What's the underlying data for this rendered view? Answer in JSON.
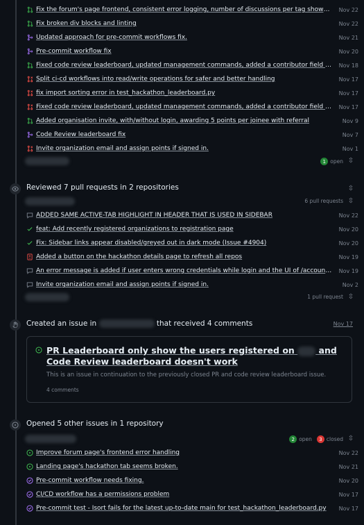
{
  "colors": {
    "open": "#3fb950",
    "closed": "#f85149",
    "merged": "#a371f7",
    "muted": "#7d8590"
  },
  "pr_list": {
    "items": [
      {
        "icon": "pr-open-icon",
        "title": "Fix the forum's page frontend, consistent error logging, number of discussions per tag shown, s...",
        "date": "Nov 22"
      },
      {
        "icon": "pr-open-icon",
        "title": "Fix broken div blocks and linting",
        "date": "Nov 22"
      },
      {
        "icon": "pr-merged-icon",
        "title": "Updated approach for pre-commit workflows fix.",
        "date": "Nov 21"
      },
      {
        "icon": "pr-merged-icon",
        "title": "Pre-commit workflow fix",
        "date": "Nov 20"
      },
      {
        "icon": "pr-open-icon",
        "title": "Fixed code review leaderboard, updated management commands, added a contributor field in t...",
        "date": "Nov 18"
      },
      {
        "icon": "pr-closed-icon",
        "title": "Split ci-cd workflows into read/write operations for safer and better handling",
        "date": "Nov 17"
      },
      {
        "icon": "pr-closed-icon",
        "title": "fix import sorting error in test_hackathon_leaderboard.py",
        "date": "Nov 17"
      },
      {
        "icon": "pr-closed-icon",
        "title": "Fixed code review leaderboard, updated management commands, added a contributor field in t...",
        "date": "Nov 17"
      },
      {
        "icon": "pr-open-icon",
        "title": "Added organisation invite, with/without login, awarding 5 points per joinee with referral",
        "date": "Nov 9"
      },
      {
        "icon": "pr-merged-icon",
        "title": "Code Review leaderboard fix",
        "date": "Nov 7"
      },
      {
        "icon": "pr-closed-icon",
        "title": "Invite organization email and assign points if signed in.",
        "date": "Nov 1"
      }
    ],
    "open_count": "1",
    "open_label": "open"
  },
  "reviews": {
    "title": "Reviewed 7 pull requests in 2 repositories",
    "count_label": "6 pull requests",
    "items": [
      {
        "icon": "comment-icon",
        "title": "ADDED SAME ACTIVE-TAB HIGHLIGHT IN HEADER THAT IS USED IN SIDEBAR",
        "date": "Nov 22"
      },
      {
        "icon": "check-icon",
        "title": "feat: Add recently registered organizations to registration page",
        "date": "Nov 20"
      },
      {
        "icon": "check-icon",
        "title": "Fix: Sidebar links appear disabled/greyed out in dark mode (Issue #4904)",
        "date": "Nov 20"
      },
      {
        "icon": "file-diff-icon",
        "title": "Added a button on the hackathon details page to refresh all repos",
        "date": "Nov 19"
      },
      {
        "icon": "comment-icon",
        "title": "An error message is added if user enters wrong credentials while login and the UI of /accounts/c...",
        "date": "Nov 19"
      },
      {
        "icon": "comment-icon",
        "title": "Invite organization email and assign points if signed in.",
        "date": "Nov 2"
      }
    ],
    "second_count_label": "1 pull request"
  },
  "created_issue": {
    "prefix": "Created an issue in",
    "suffix": "that received 4 comments",
    "date": "Nov 17",
    "card_title_a": "PR Leaderboard only show the users registered on",
    "card_title_b": "and Code Review leaderboard doesn't work",
    "card_desc": "This is an issue in continuation to the previously closed PR and code review leaderboard issue.",
    "card_comments": "4 comments"
  },
  "opened_issues": {
    "title": "Opened 5 other issues in 1 repository",
    "open_count": "2",
    "open_label": "open",
    "closed_count": "3",
    "closed_label": "closed",
    "items": [
      {
        "icon": "issue-open-icon",
        "title": "Improve forum page's frontend error handling",
        "date": "Nov 22"
      },
      {
        "icon": "issue-open-icon",
        "title": "Landing page's hackathon tab seems broken.",
        "date": "Nov 21"
      },
      {
        "icon": "issue-closed-icon",
        "title": "Pre-commit workflow needs fixing.",
        "date": "Nov 20"
      },
      {
        "icon": "issue-closed-icon",
        "title": "CI/CD workflow has a permissions problem",
        "date": "Nov 17"
      },
      {
        "icon": "issue-closed-icon",
        "title": "Pre-commit test - Isort fails for the latest up-to-date main for test_hackathon_leaderboard.py",
        "date": "Nov 17"
      }
    ]
  }
}
